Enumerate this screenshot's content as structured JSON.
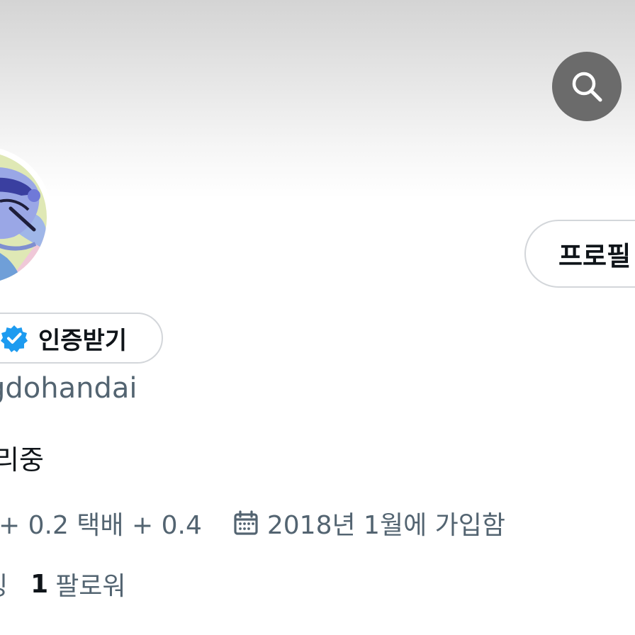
{
  "header": {
    "search_icon": "search-icon",
    "search_button_color": "#6b6b6b"
  },
  "profile": {
    "edit_profile_label": "프로필",
    "verify_label": "인증받기",
    "verify_icon": "verified-badge-icon",
    "verify_color": "#1d9bf0",
    "handle": "gdohandai",
    "bio": "리중",
    "location_text": "+ 0.2 택배 + 0.4",
    "joined_icon": "calendar-icon",
    "joined_text": "2018년 1월에 가입함",
    "following_label": "잉",
    "followers_count": "1",
    "followers_label": "팔로워"
  }
}
